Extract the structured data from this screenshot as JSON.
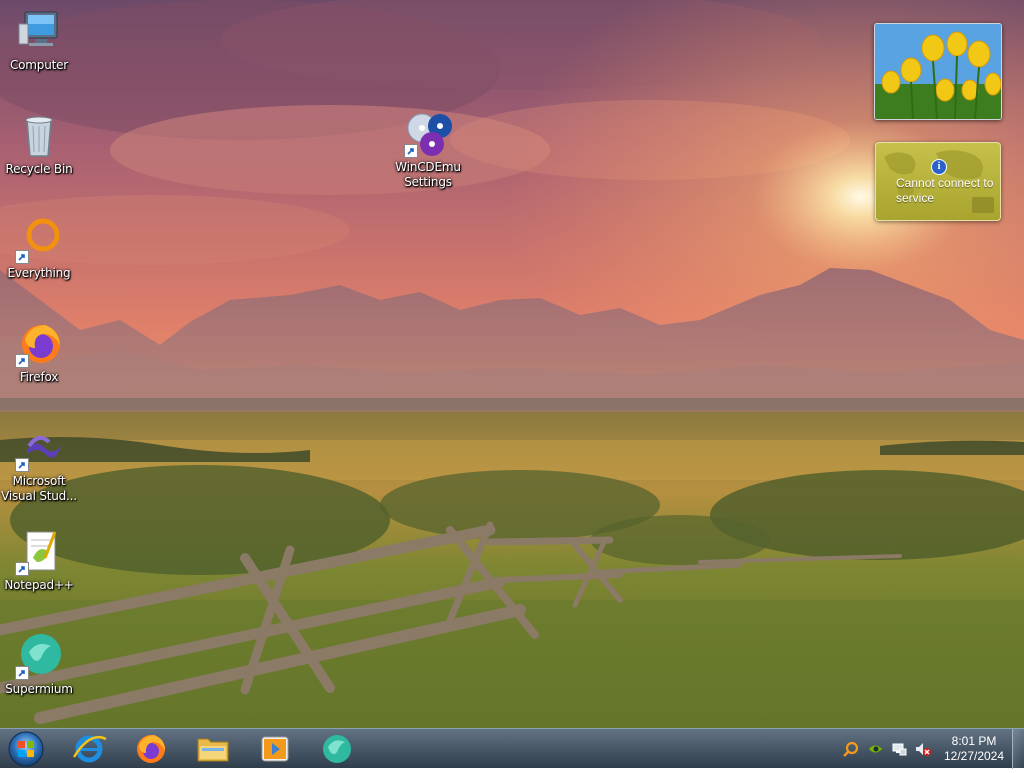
{
  "desktop": {
    "icons": [
      {
        "label": "Computer"
      },
      {
        "label": "Recycle Bin"
      },
      {
        "label": "Everything"
      },
      {
        "label": "Firefox"
      },
      {
        "label": "Microsoft Visual Stud..."
      },
      {
        "label": "Notepad++"
      },
      {
        "label": "Supermium"
      },
      {
        "label": "WinCDEmu Settings"
      }
    ]
  },
  "gadgets": {
    "weather": {
      "message": "Cannot connect to service",
      "icon": "info-icon"
    },
    "slideshow": {
      "icon": "tulips-photo"
    }
  },
  "taskbar": {
    "pinned": [
      {
        "name": "internet-explorer",
        "icon": "ie-icon"
      },
      {
        "name": "firefox",
        "icon": "firefox-icon"
      },
      {
        "name": "windows-explorer",
        "icon": "folder-icon"
      },
      {
        "name": "media-player",
        "icon": "media-icon"
      },
      {
        "name": "supermium",
        "icon": "supermium-icon"
      }
    ],
    "clock": {
      "time": "8:01 PM",
      "date": "12/27/2024"
    }
  },
  "colors": {
    "sky_top": "#7b4f6a",
    "sky_mid": "#e7865e",
    "grass": "#6f7a31",
    "taskbar": "#2d3f52"
  }
}
